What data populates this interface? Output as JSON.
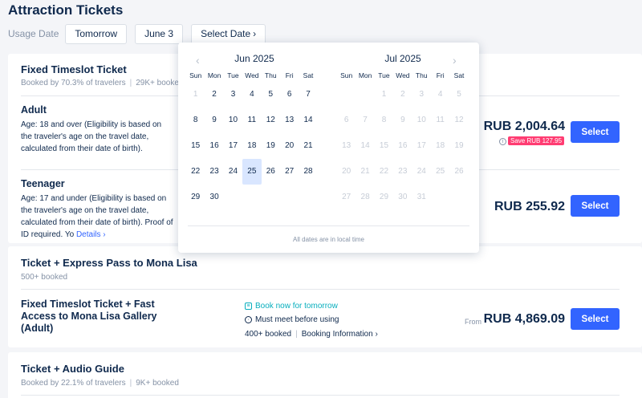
{
  "page_title": "Attraction Tickets",
  "usage": {
    "label": "Usage Date",
    "options": [
      "Tomorrow",
      "June 3",
      "Select Date"
    ],
    "chevron": "chevron-right-icon"
  },
  "group1": {
    "title": "Fixed Timeslot Ticket",
    "booked_by": "Booked by 70.3% of travelers",
    "booked_count": "29K+ booked",
    "tickets": [
      {
        "name": "Adult",
        "desc": "Age:  18 and over (Eligibility is based on the traveler's age on the travel date, calculated from their date of birth).",
        "price": "RUB 2,004.64",
        "save": "Save RUB 127.95",
        "select": "Select"
      },
      {
        "name": "Teenager",
        "desc": "Age:  17 and under (Eligibility is based on the traveler's age on the travel date, calculated from their date of birth). Proof of ID required. Yo",
        "details": "Details",
        "price": "RUB 255.92",
        "select": "Select"
      }
    ]
  },
  "group2": {
    "title": "Ticket + Express Pass to Mona Lisa",
    "booked_count": "500+ booked",
    "ticket": {
      "name_lines": [
        "Fixed Timeslot Ticket + Fast",
        "Access to Mona Lisa Gallery",
        "(Adult)"
      ],
      "book_now": "Book now for tomorrow",
      "must_meet": "Must meet before using",
      "booked": "400+ booked",
      "booking_info": "Booking Information",
      "from": "From",
      "price": "RUB 4,869.09",
      "select": "Select"
    }
  },
  "group3": {
    "title": "Ticket + Audio Guide",
    "booked_by": "Booked by 22.1% of travelers",
    "booked_count": "9K+ booked"
  },
  "calendar": {
    "weekdays": [
      "Sun",
      "Mon",
      "Tue",
      "Wed",
      "Thu",
      "Fri",
      "Sat"
    ],
    "footer": "All dates are in local time",
    "selected_date": "25",
    "months": [
      {
        "name": "Jun 2025",
        "lead_blanks": 0,
        "days": [
          "1",
          "2",
          "3",
          "4",
          "5",
          "6",
          "7",
          "8",
          "9",
          "10",
          "11",
          "12",
          "13",
          "14",
          "15",
          "16",
          "17",
          "18",
          "19",
          "20",
          "21",
          "22",
          "23",
          "24",
          "25",
          "26",
          "27",
          "28",
          "29",
          "30"
        ],
        "disabled_days": [
          "1"
        ]
      },
      {
        "name": "Jul 2025",
        "lead_blanks": 2,
        "days": [
          "1",
          "2",
          "3",
          "4",
          "5",
          "6",
          "7",
          "8",
          "9",
          "10",
          "11",
          "12",
          "13",
          "14",
          "15",
          "16",
          "17",
          "18",
          "19",
          "20",
          "21",
          "22",
          "23",
          "24",
          "25",
          "26",
          "27",
          "28",
          "29",
          "30",
          "31"
        ],
        "disabled_days": [
          "1",
          "2",
          "3",
          "4",
          "5",
          "6",
          "7",
          "8",
          "9",
          "10",
          "11",
          "12",
          "13",
          "14",
          "15",
          "16",
          "17",
          "18",
          "19",
          "20",
          "21",
          "22",
          "23",
          "24",
          "25",
          "26",
          "27",
          "28",
          "29",
          "30",
          "31"
        ]
      }
    ],
    "prev_icon": "chevron-left-icon",
    "next_icon": "chevron-right-icon"
  },
  "colors": {
    "accent": "#3264ff",
    "save_badge": "#ff3c72",
    "teal": "#06aebd",
    "selected_day_bg": "#d9e6ff"
  }
}
